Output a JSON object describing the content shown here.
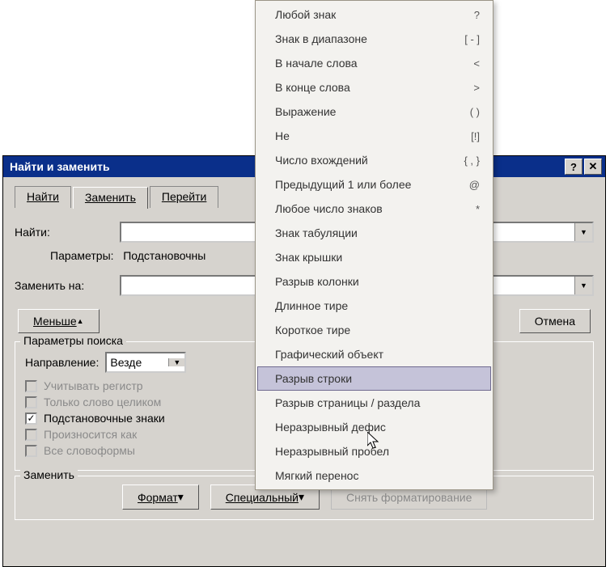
{
  "dialog": {
    "title": "Найти и заменить",
    "help_symbol": "?",
    "close_symbol": "✕"
  },
  "tabs": {
    "find": "Найти",
    "replace": "Заменить",
    "goto": "Перейти"
  },
  "fields": {
    "find_label": "Найти:",
    "params_label": "Параметры:",
    "params_value": "Подстановочны",
    "replace_label": "Заменить на:"
  },
  "buttons": {
    "less": "Меньше",
    "cancel": "Отмена",
    "format": "Формат",
    "special": "Специальный",
    "clear_format": "Снять форматирование"
  },
  "search_options": {
    "group_title": "Параметры поиска",
    "direction_label": "Направление:",
    "direction_value": "Везде",
    "match_case": "Учитывать регистр",
    "whole_word": "Только слово целиком",
    "wildcards": "Подстановочные знаки",
    "sounds_like": "Произносится как",
    "word_forms": "Все словоформы"
  },
  "bottom_group_title": "Заменить",
  "menu": {
    "items": [
      {
        "label": "Любой знак",
        "symbol": "?"
      },
      {
        "label": "Знак в диапазоне",
        "symbol": "[ - ]"
      },
      {
        "label": "В начале слова",
        "symbol": "<"
      },
      {
        "label": "В конце слова",
        "symbol": ">"
      },
      {
        "label": "Выражение",
        "symbol": "( )"
      },
      {
        "label": "Не",
        "symbol": "[!]"
      },
      {
        "label": "Число вхождений",
        "symbol": "{ , }"
      },
      {
        "label": "Предыдущий 1 или более",
        "symbol": "@"
      },
      {
        "label": "Любое число знаков",
        "symbol": "*"
      },
      {
        "label": "Знак табуляции",
        "symbol": ""
      },
      {
        "label": "Знак крышки",
        "symbol": ""
      },
      {
        "label": "Разрыв колонки",
        "symbol": ""
      },
      {
        "label": "Длинное тире",
        "symbol": ""
      },
      {
        "label": "Короткое тире",
        "symbol": ""
      },
      {
        "label": "Графический объект",
        "symbol": ""
      },
      {
        "label": "Разрыв строки",
        "symbol": ""
      },
      {
        "label": "Разрыв страницы / раздела",
        "symbol": ""
      },
      {
        "label": "Неразрывный дефис",
        "symbol": ""
      },
      {
        "label": "Неразрывный пробел",
        "symbol": ""
      },
      {
        "label": "Мягкий перенос",
        "symbol": ""
      }
    ],
    "highlighted_index": 15
  }
}
